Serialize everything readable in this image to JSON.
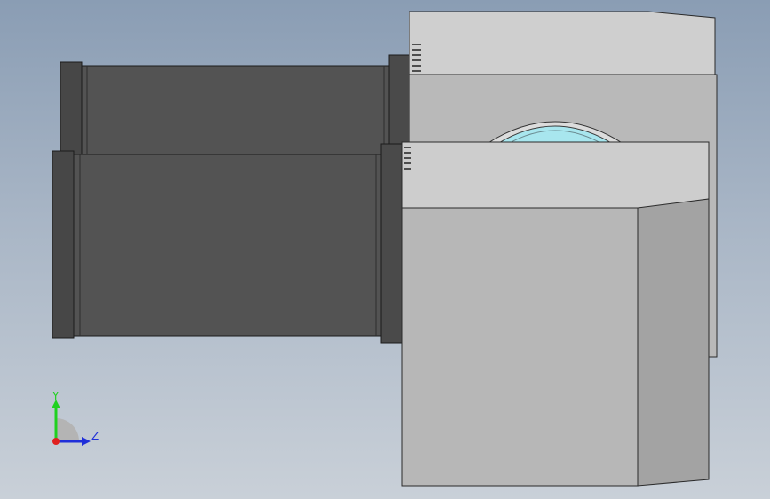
{
  "viewport": {
    "background_top": "#8a9db4",
    "background_bottom": "#c9d0d8"
  },
  "model": {
    "motor_body_color": "#535353",
    "housing_top_color": "#cccccc",
    "housing_side_color": "#a9a9a9",
    "lens_color": "#a8e6ee"
  },
  "triad": {
    "y_label": "Y",
    "z_label": "Z",
    "y_color": "#1fd11f",
    "z_color": "#1f2fd9",
    "x_color": "#e0201f"
  }
}
